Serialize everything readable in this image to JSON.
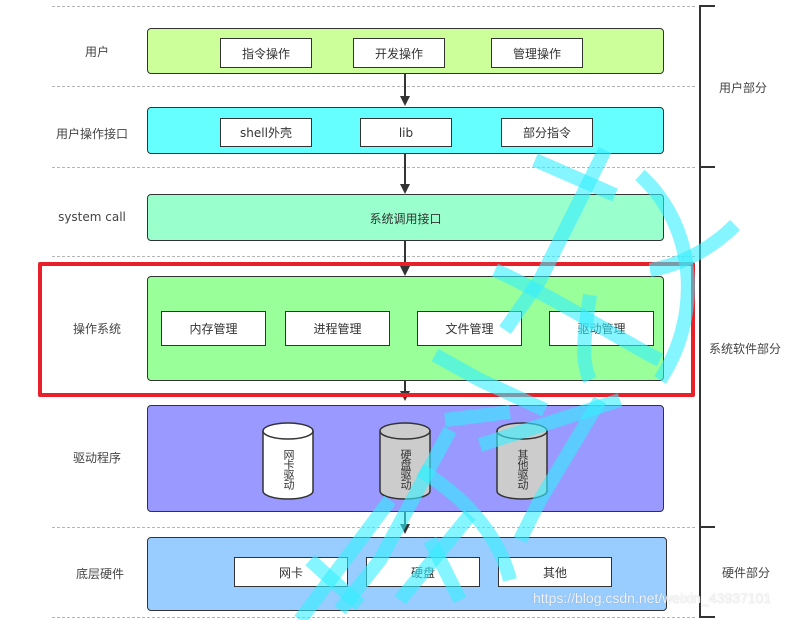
{
  "layers": [
    {
      "label": "用户",
      "color": "#ccff99",
      "items": [
        "指令操作",
        "开发操作",
        "管理操作"
      ]
    },
    {
      "label": "用户操作接口",
      "color": "#66ffff",
      "items": [
        "shell外壳",
        "lib",
        "部分指令"
      ]
    },
    {
      "label": "system call",
      "color": "#99ffcc",
      "center_text": "系统调用接口"
    },
    {
      "label": "操作系统",
      "color": "#99ff99",
      "items": [
        "内存管理",
        "进程管理",
        "文件管理",
        "驱动管理"
      ]
    },
    {
      "label": "驱动程序",
      "color": "#9999ff",
      "cylinders": [
        {
          "label": "网卡驱动",
          "fill": "#ffffff"
        },
        {
          "label": "硬盘驱动",
          "fill": "#cccccc"
        },
        {
          "label": "其他驱动",
          "fill": "#cccccc"
        }
      ]
    },
    {
      "label": "底层硬件",
      "color": "#99ccff",
      "items": [
        "网卡",
        "硬盘",
        "其他"
      ]
    }
  ],
  "sections": [
    {
      "label": "用户部分"
    },
    {
      "label": "系统软件部分"
    },
    {
      "label": "硬件部分"
    }
  ],
  "highlight": {
    "target": "操作系统",
    "color": "#e8202a"
  },
  "watermark": {
    "text": "https://blog.csdn.net/weixin_43937101",
    "scribble_color": "#33eeff"
  }
}
